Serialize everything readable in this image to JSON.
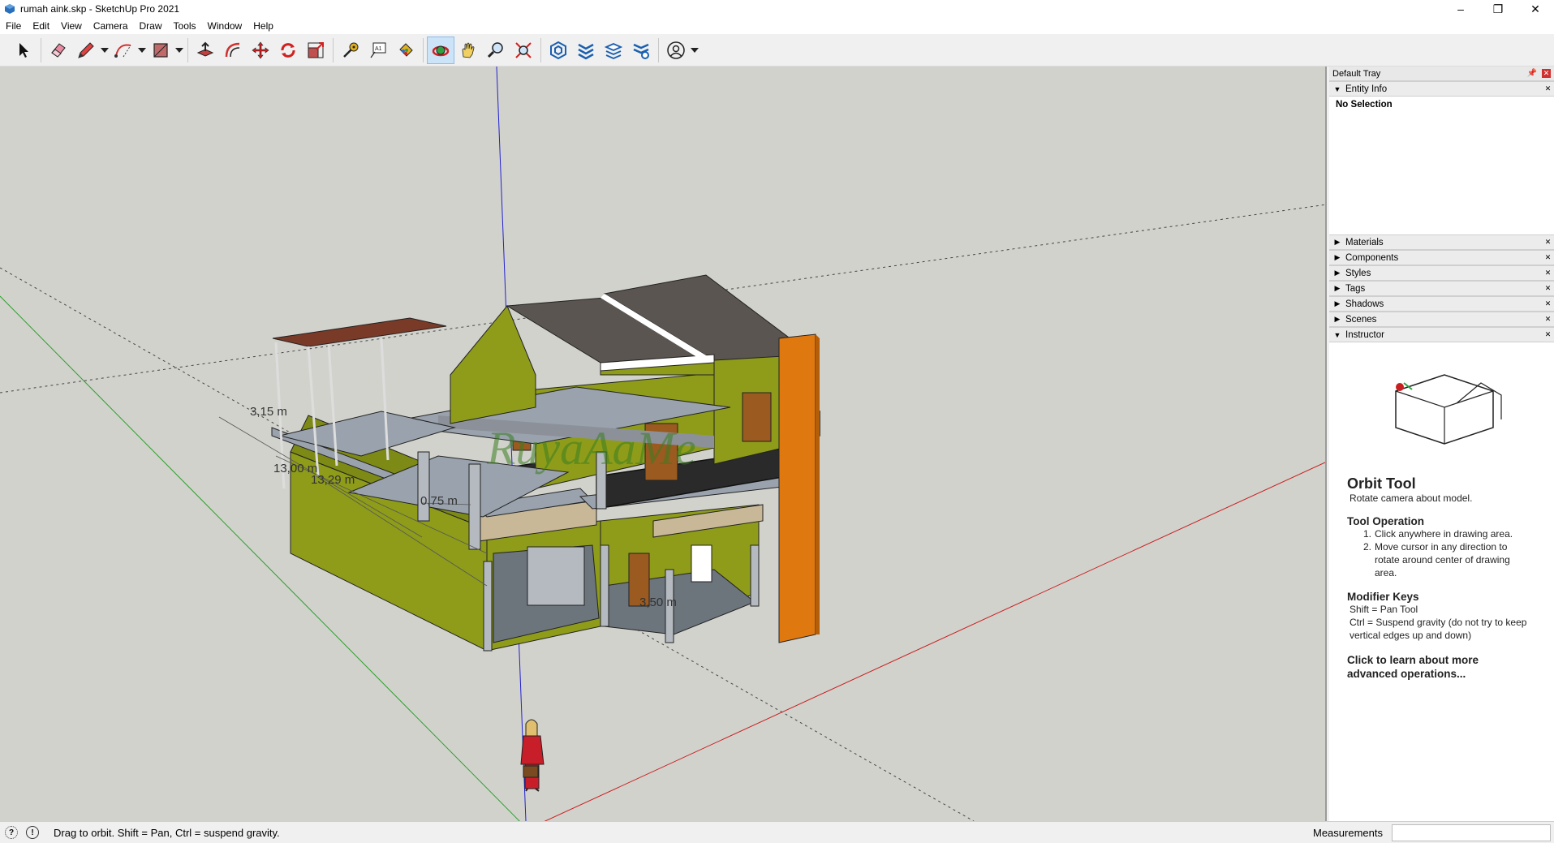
{
  "window": {
    "title": "rumah aink.skp - SketchUp Pro 2021",
    "minimize": "–",
    "maximize": "❐",
    "close": "✕"
  },
  "menu": [
    "File",
    "Edit",
    "View",
    "Camera",
    "Draw",
    "Tools",
    "Window",
    "Help"
  ],
  "toolbar": {
    "tools": [
      {
        "name": "select-icon"
      },
      {
        "name": "eraser-icon"
      },
      {
        "name": "pencil-icon"
      },
      {
        "name": "arc-icon"
      },
      {
        "name": "rectangle-icon"
      },
      {
        "name": "push-pull-icon"
      },
      {
        "name": "offset-icon"
      },
      {
        "name": "move-icon"
      },
      {
        "name": "rotate-icon"
      },
      {
        "name": "scale-icon"
      },
      {
        "name": "tape-measure-icon"
      },
      {
        "name": "text-icon"
      },
      {
        "name": "paint-bucket-icon"
      },
      {
        "name": "orbit-icon"
      },
      {
        "name": "pan-icon"
      },
      {
        "name": "zoom-icon"
      },
      {
        "name": "zoom-extents-icon"
      },
      {
        "name": "warehouse-icon"
      },
      {
        "name": "extension-warehouse-icon"
      },
      {
        "name": "layout-icon"
      },
      {
        "name": "extension-manager-icon"
      },
      {
        "name": "account-icon"
      }
    ],
    "active_tool": "orbit-icon"
  },
  "viewport": {
    "dimensions": [
      "3,15 m",
      "13,00 m",
      "13,29 m",
      "0,75 m",
      "3,50 m"
    ],
    "watermark": "RuyaAaMe",
    "colors": {
      "background": "#d2d2cd",
      "wall": "#8e9c1a",
      "wall_dark": "#6f7a12",
      "roof": "#5a5550",
      "slab": "#9aa3ad",
      "orange": "#e07810"
    }
  },
  "tray": {
    "title": "Default Tray",
    "entity_info": {
      "label": "Entity Info",
      "body": "No Selection"
    },
    "panels": [
      "Materials",
      "Components",
      "Styles",
      "Tags",
      "Shadows",
      "Scenes"
    ],
    "instructor": {
      "label": "Instructor",
      "tool_title": "Orbit Tool",
      "tool_sub": "Rotate camera about model.",
      "op_heading": "Tool Operation",
      "ops": [
        "Click anywhere in drawing area.",
        "Move cursor in any direction to rotate around center of drawing area."
      ],
      "mod_heading": "Modifier Keys",
      "mods": [
        "Shift = Pan Tool",
        "Ctrl = Suspend gravity (do not try to keep vertical edges up and down)"
      ],
      "link": "Click to learn about more advanced operations..."
    }
  },
  "status": {
    "hint": "Drag to orbit. Shift = Pan, Ctrl = suspend gravity.",
    "measurements_label": "Measurements",
    "measurements_value": ""
  }
}
